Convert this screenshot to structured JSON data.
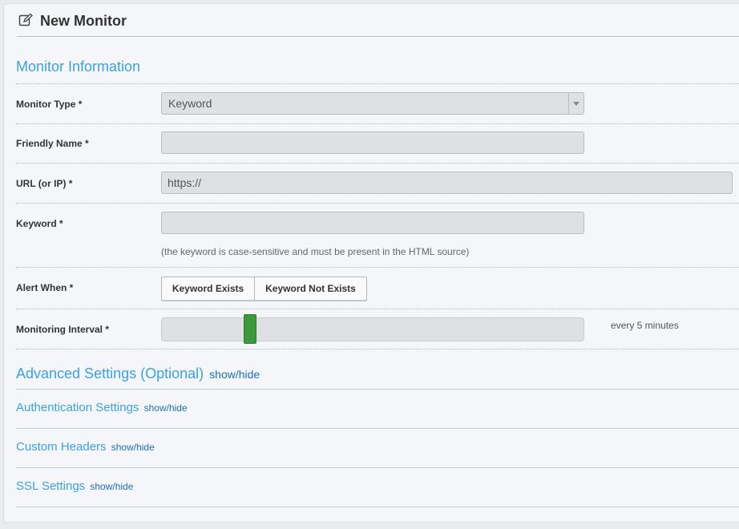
{
  "header": {
    "title": "New Monitor",
    "icon": "edit-icon"
  },
  "monitor_info": {
    "title": "Monitor Information"
  },
  "fields": {
    "monitor_type": {
      "label": "Monitor Type *",
      "value": "Keyword"
    },
    "friendly_name": {
      "label": "Friendly Name *",
      "value": ""
    },
    "url": {
      "label": "URL (or IP) *",
      "value": "https://"
    },
    "keyword": {
      "label": "Keyword *",
      "value": "",
      "hint": "(the keyword is case-sensitive and must be present in the HTML source)"
    },
    "alert_when": {
      "label": "Alert When *",
      "options": [
        "Keyword Exists",
        "Keyword Not Exists"
      ]
    },
    "interval": {
      "label": "Monitoring Interval *",
      "value_text": "every 5 minutes",
      "slider_fraction": 0.2,
      "handle_color": "#3c9a3c"
    }
  },
  "advanced": {
    "title": "Advanced Settings (Optional)",
    "toggle": "show/hide"
  },
  "subsections": [
    {
      "title": "Authentication Settings",
      "toggle": "show/hide"
    },
    {
      "title": "Custom Headers",
      "toggle": "show/hide"
    },
    {
      "title": "SSL Settings",
      "toggle": "show/hide"
    }
  ],
  "colors": {
    "accent": "#3aa1e0",
    "link": "#1c6fb3"
  }
}
